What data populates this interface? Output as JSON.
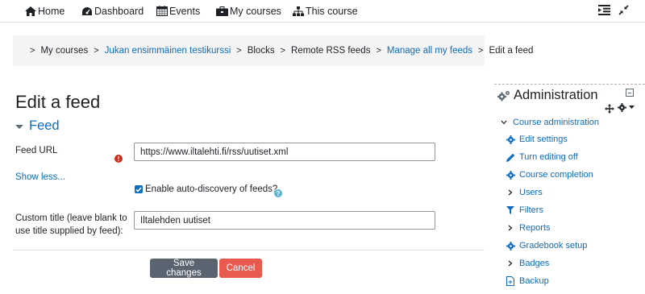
{
  "navbar": {
    "items": [
      {
        "label": "Home",
        "icon": "home-icon"
      },
      {
        "label": "Dashboard",
        "icon": "dashboard-icon"
      },
      {
        "label": "Events",
        "icon": "calendar-icon"
      },
      {
        "label": "My courses",
        "icon": "briefcase-icon"
      },
      {
        "label": "This course",
        "icon": "sitemap-icon"
      }
    ],
    "right_icons": [
      "block-drawer-icon",
      "collapse-icon"
    ]
  },
  "breadcrumb": {
    "items": [
      {
        "label": "My courses",
        "link": false
      },
      {
        "label": "Jukan ensimmäinen testikurssi",
        "link": true
      },
      {
        "label": "Blocks",
        "link": false
      },
      {
        "label": "Remote RSS feeds",
        "link": false
      },
      {
        "label": "Manage all my feeds",
        "link": true
      },
      {
        "label": "Edit a feed",
        "link": false
      }
    ]
  },
  "page": {
    "title": "Edit a feed",
    "section": "Feed",
    "feed_url_label": "Feed URL",
    "feed_url_value": "https://www.iltalehti.fi/rss/uutiset.xml",
    "show_less": "Show less...",
    "autodiscovery_label": "Enable auto-discovery of feeds?",
    "custom_title_label_1": "Custom title (leave blank to",
    "custom_title_label_2": "use title supplied by feed):",
    "custom_title_value": "Iltalehden uutiset",
    "save_label": "Save changes",
    "cancel_label": "Cancel"
  },
  "admin": {
    "title": "Administration",
    "items": [
      {
        "label": "Course administration",
        "icon": "chevron-down-icon"
      },
      {
        "label": "Edit settings",
        "icon": "gear-icon"
      },
      {
        "label": "Turn editing off",
        "icon": "pencil-icon"
      },
      {
        "label": "Course completion",
        "icon": "gear-icon"
      },
      {
        "label": "Users",
        "icon": "chevron-right-icon"
      },
      {
        "label": "Filters",
        "icon": "filter-icon"
      },
      {
        "label": "Reports",
        "icon": "chevron-right-icon"
      },
      {
        "label": "Gradebook setup",
        "icon": "gear-icon"
      },
      {
        "label": "Badges",
        "icon": "chevron-right-icon"
      },
      {
        "label": "Backup",
        "icon": "file-icon"
      }
    ]
  },
  "colors": {
    "link": "#0f6cbf",
    "save_button": "#5a6470",
    "cancel_button": "#e85a4e",
    "breadcrumb_bg": "#f4f4f4"
  }
}
